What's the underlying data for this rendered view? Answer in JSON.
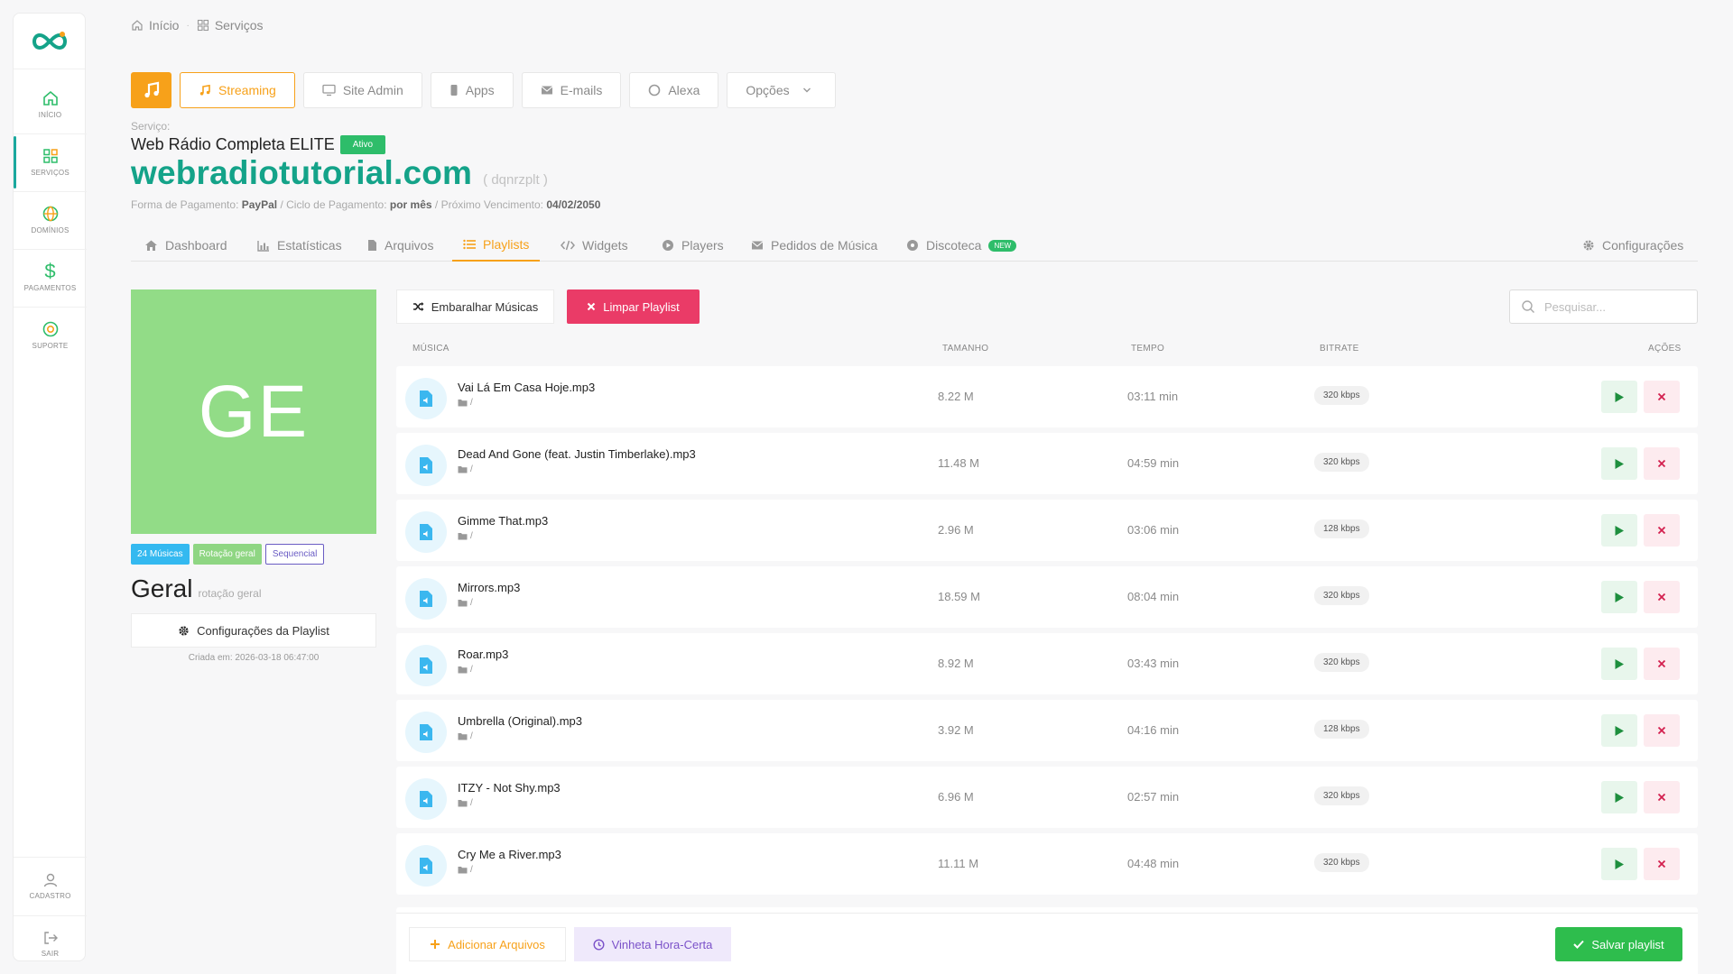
{
  "sidebar": {
    "items": [
      {
        "label": "Início"
      },
      {
        "label": "Serviços"
      },
      {
        "label": "Domínios"
      },
      {
        "label": "Pagamentos"
      },
      {
        "label": "Suporte"
      }
    ],
    "bottom": [
      {
        "label": "Cadastro"
      },
      {
        "label": "Sair"
      }
    ]
  },
  "breadcrumb": {
    "home": "Início",
    "current": "Serviços"
  },
  "service_tabs": {
    "streaming": "Streaming",
    "site_admin": "Site Admin",
    "apps": "Apps",
    "emails": "E-mails",
    "alexa": "Alexa",
    "options": "Opções"
  },
  "service": {
    "label": "Serviço:",
    "name": "Web Rádio Completa ELITE",
    "status": "Ativo",
    "domain": "webradiotutorial.com",
    "code": "( dqnrzplt )",
    "payment_method_label": "Forma de Pagamento:",
    "payment_method": "PayPal",
    "cycle_label": "/ Ciclo de Pagamento:",
    "cycle": "por mês",
    "due_label": "/ Próximo Vencimento:",
    "due": "04/02/2050"
  },
  "sections": {
    "dashboard": "Dashboard",
    "stats": "Estatísticas",
    "files": "Arquivos",
    "playlists": "Playlists",
    "widgets": "Widgets",
    "players": "Players",
    "requests": "Pedidos de Música",
    "discoteca": "Discoteca",
    "new_badge": "NEW",
    "settings": "Configurações"
  },
  "playlist": {
    "initials": "GE",
    "tag_count": "24 Músicas",
    "tag_type": "Rotação geral",
    "tag_order": "Sequencial",
    "title": "Geral",
    "subtitle": "rotação geral",
    "config_label": "Configurações da Playlist",
    "created": "Criada em: 2026-03-18 06:47:00"
  },
  "toolbar": {
    "shuffle": "Embaralhar Músicas",
    "clear": "Limpar Playlist",
    "search_placeholder": "Pesquisar..."
  },
  "table": {
    "headers": {
      "music": "Música",
      "size": "Tamanho",
      "time": "Tempo",
      "bitrate": "Bitrate",
      "actions": "Ações"
    },
    "rows": [
      {
        "name": "Vai Lá Em Casa Hoje.mp3",
        "path": "/",
        "size": "8.22 M",
        "time": "03:11 min",
        "bitrate": "320 kbps"
      },
      {
        "name": "Dead And Gone (feat. Justin Timberlake).mp3",
        "path": "/",
        "size": "11.48 M",
        "time": "04:59 min",
        "bitrate": "320 kbps"
      },
      {
        "name": "Gimme That.mp3",
        "path": "/",
        "size": "2.96 M",
        "time": "03:06 min",
        "bitrate": "128 kbps"
      },
      {
        "name": "Mirrors.mp3",
        "path": "/",
        "size": "18.59 M",
        "time": "08:04 min",
        "bitrate": "320 kbps"
      },
      {
        "name": "Roar.mp3",
        "path": "/",
        "size": "8.92 M",
        "time": "03:43 min",
        "bitrate": "320 kbps"
      },
      {
        "name": "Umbrella (Original).mp3",
        "path": "/",
        "size": "3.92 M",
        "time": "04:16 min",
        "bitrate": "128 kbps"
      },
      {
        "name": "ITZY - Not Shy.mp3",
        "path": "/",
        "size": "6.96 M",
        "time": "02:57 min",
        "bitrate": "320 kbps"
      },
      {
        "name": "Cry Me a River.mp3",
        "path": "/",
        "size": "11.11 M",
        "time": "04:48 min",
        "bitrate": "320 kbps"
      }
    ]
  },
  "footer": {
    "add_files": "Adicionar Arquivos",
    "vinheta": "Vinheta Hora-Certa",
    "save": "Salvar playlist"
  },
  "colors": {
    "brand": "#14a389",
    "accent": "#f7a11a",
    "danger": "#ea3b67",
    "success": "#2ebd4d",
    "cover": "#92dc87"
  }
}
